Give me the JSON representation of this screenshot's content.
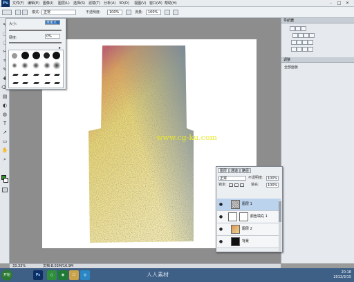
{
  "app": {
    "logo": "Ps"
  },
  "menubar": {
    "items": [
      "文件(F)",
      "编辑(E)",
      "图像(I)",
      "图层(L)",
      "选择(S)",
      "滤镜(T)",
      "分析(A)",
      "3D(D)",
      "视图(V)",
      "窗口(W)",
      "帮助(H)"
    ],
    "window_buttons": [
      "–",
      "□",
      "✕"
    ]
  },
  "options_bar": {
    "mode_label": "模式:",
    "mode_value": "正常",
    "opacity_label": "不透明度:",
    "opacity_value": "100%",
    "flow_label": "流量:",
    "flow_value": "100%"
  },
  "brush_panel": {
    "size_label": "大小:",
    "size_value": "未定义",
    "hardness_label": "硬度:",
    "hardness_value": "0%"
  },
  "right_panel": {
    "top_header": "导航器",
    "section2_header": "调整",
    "section2_sub": "全部面板"
  },
  "watermark": {
    "text": "www.cg-ku.com"
  },
  "layers_panel": {
    "tabs": [
      "图层",
      "通道",
      "路径"
    ],
    "blend_mode": "正常",
    "opacity_label": "不透明度:",
    "opacity_value": "100%",
    "lock_label": "锁定:",
    "fill_label": "填充:",
    "fill_value": "100%",
    "layers": [
      {
        "name": "图层 1",
        "selected": true
      },
      {
        "name": "颜色填充 1",
        "selected": false
      },
      {
        "name": "图层 2",
        "selected": false
      },
      {
        "name": "背景",
        "selected": false
      }
    ]
  },
  "status_bar": {
    "zoom": "33.33%",
    "doc": "文档:8.03M/16.9M"
  },
  "taskbar": {
    "start_label": "开始",
    "apps": [
      "Ps",
      "○",
      "◉",
      "☐",
      "◎"
    ],
    "watermark": "人人素材",
    "clock_time": "20:18",
    "clock_date": "2013/3/15"
  },
  "colors": {
    "accent": "#2d6db6",
    "selected_layer": "#bcd3ee",
    "watermark_yellow": "#e8e82a"
  }
}
